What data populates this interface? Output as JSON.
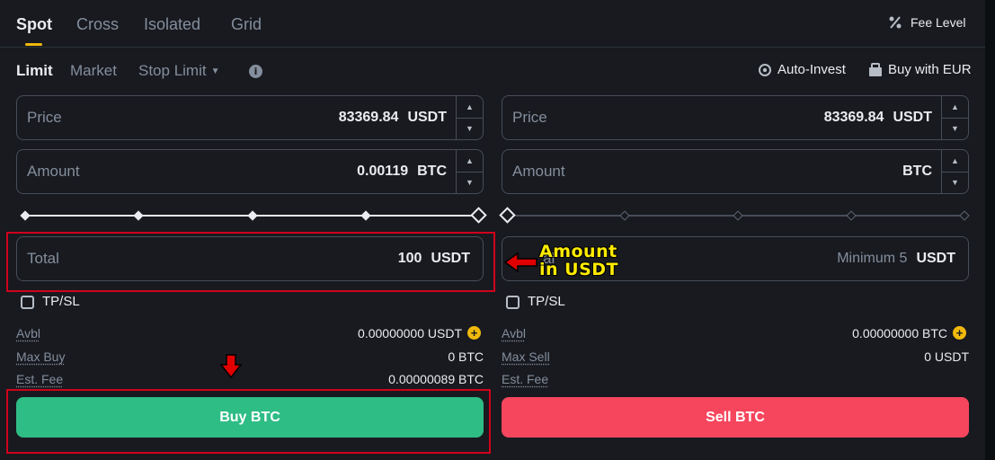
{
  "top_tabs": [
    "Spot",
    "Cross",
    "Isolated",
    "Grid"
  ],
  "fee_level": "Fee Level",
  "order_types": [
    "Limit",
    "Market",
    "Stop Limit"
  ],
  "links": {
    "auto_invest": "Auto-Invest",
    "buy_with": "Buy with EUR"
  },
  "buy": {
    "price_label": "Price",
    "price_value": "83369.84",
    "price_unit": "USDT",
    "amount_label": "Amount",
    "amount_value": "0.00119",
    "amount_unit": "BTC",
    "total_label": "Total",
    "total_value": "100",
    "total_unit": "USDT",
    "slider_fraction": 1.0,
    "tpsl": "TP/SL",
    "avbl_label": "Avbl",
    "avbl_value": "0.00000000 USDT",
    "max_label": "Max Buy",
    "max_value": "0 BTC",
    "fee_label": "Est. Fee",
    "fee_value": "0.00000089 BTC",
    "button": "Buy BTC"
  },
  "sell": {
    "price_label": "Price",
    "price_value": "83369.84",
    "price_unit": "USDT",
    "amount_label": "Amount",
    "amount_value": "",
    "amount_unit": "BTC",
    "total_label_partial": "al",
    "total_placeholder": "Minimum 5",
    "total_unit": "USDT",
    "slider_fraction": 0.0,
    "tpsl": "TP/SL",
    "avbl_label": "Avbl",
    "avbl_value": "0.00000000 BTC",
    "max_label": "Max Sell",
    "max_value": "0 USDT",
    "fee_label": "Est. Fee",
    "button": "Sell BTC"
  },
  "annotation": {
    "line1": "Amount",
    "line2": "in USDT"
  },
  "colors": {
    "accent": "#f0b90b",
    "buy": "#2ebd85",
    "sell": "#f6465d",
    "background": "#181a20",
    "annotation_red": "#d0021b",
    "annotation_text": "#ffeb00"
  }
}
